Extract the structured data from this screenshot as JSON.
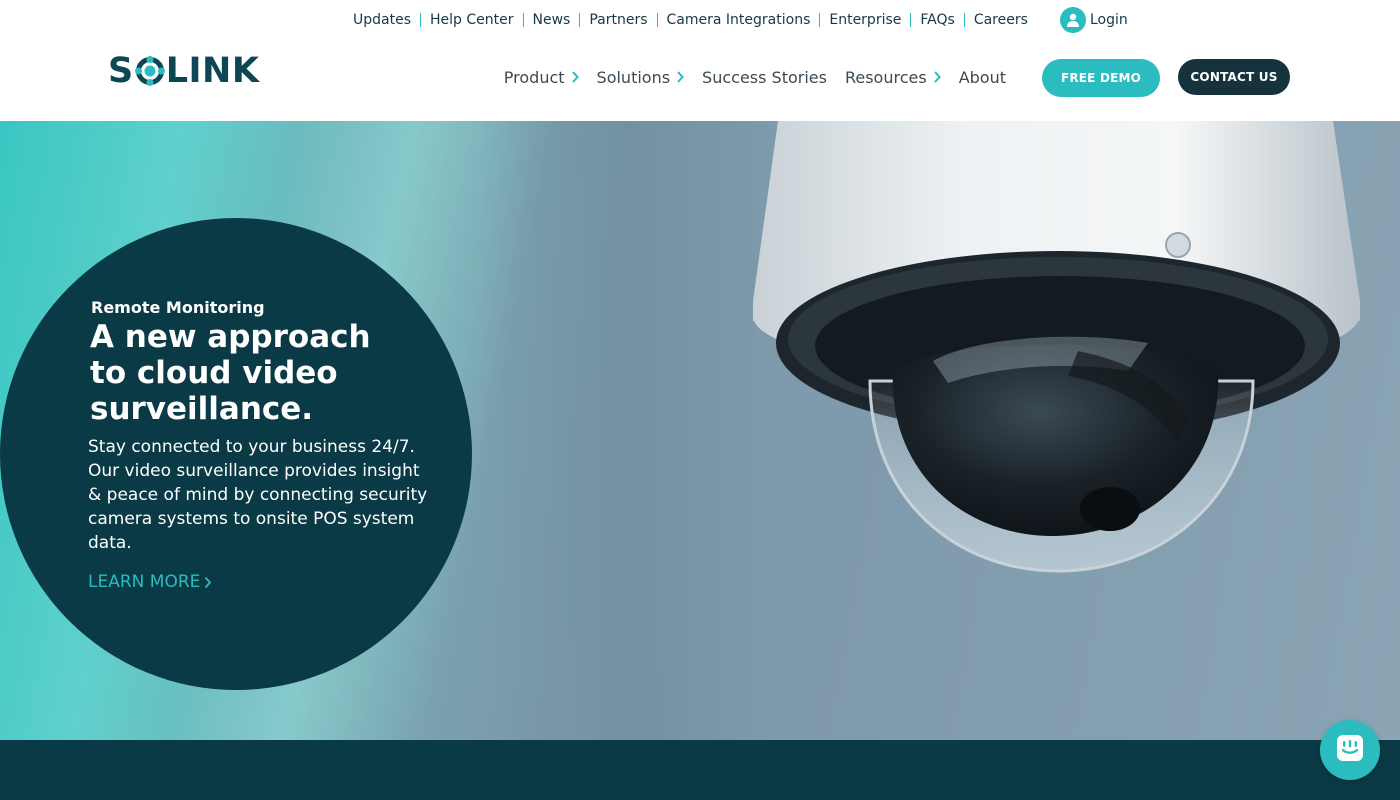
{
  "utility_nav": {
    "links": [
      "Updates",
      "Help Center",
      "News",
      "Partners",
      "Camera Integrations",
      "Enterprise",
      "FAQs",
      "Careers"
    ],
    "login_label": "Login"
  },
  "logo": {
    "prefix": "S",
    "suffix": "LINK",
    "brand_color": "#0d4654",
    "accent_color": "#2bbcbf"
  },
  "main_nav": {
    "items": [
      {
        "label": "Product",
        "has_submenu": true
      },
      {
        "label": "Solutions",
        "has_submenu": true
      },
      {
        "label": "Success Stories",
        "has_submenu": false
      },
      {
        "label": "Resources",
        "has_submenu": true
      },
      {
        "label": "About",
        "has_submenu": false
      }
    ],
    "demo_button": "FREE DEMO",
    "contact_button": "CONTACT US"
  },
  "hero": {
    "eyebrow": "Remote Monitoring",
    "title_line1": "A new approach",
    "title_line2": "to cloud video",
    "title_line3": "surveillance.",
    "body": "Stay connected to your business 24/7. Our video surveillance provides insight & peace of mind by connecting security camera systems to onsite POS system data.",
    "cta_label": "LEARN MORE",
    "circle_color": "#093a45"
  },
  "icons": {
    "login": "user-icon",
    "nav_submenu": "chevron-right-icon",
    "cta": "chevron-right-icon",
    "chat": "chat-icon"
  },
  "colors": {
    "accent": "#2bbcbf",
    "dark": "#16333d",
    "band": "#093a45"
  }
}
